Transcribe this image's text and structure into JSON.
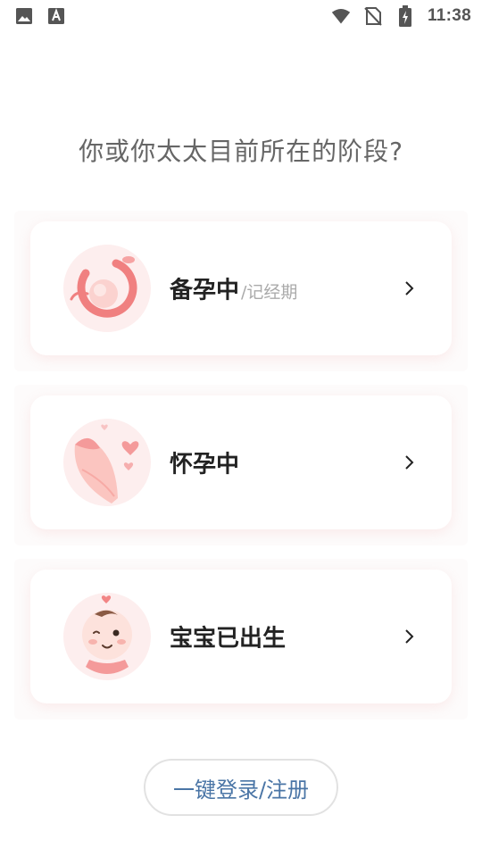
{
  "status_bar": {
    "time": "11:38",
    "icons": [
      "image-notification-icon",
      "text-notification-icon",
      "wifi-icon",
      "no-sim-icon",
      "battery-charging-icon"
    ]
  },
  "question": "你或你太太目前所在的阶段?",
  "stages": [
    {
      "title": "备孕中",
      "subtitle": "/记经期",
      "icon": "ovulation-illustration-icon"
    },
    {
      "title": "怀孕中",
      "subtitle": "",
      "icon": "pregnant-belly-illustration-icon"
    },
    {
      "title": "宝宝已出生",
      "subtitle": "",
      "icon": "baby-illustration-icon"
    }
  ],
  "login": {
    "label": "一键登录/注册"
  },
  "colors": {
    "accent_pink": "#f26d6d",
    "link_blue": "#4a75a6",
    "text_gray": "#666666"
  }
}
